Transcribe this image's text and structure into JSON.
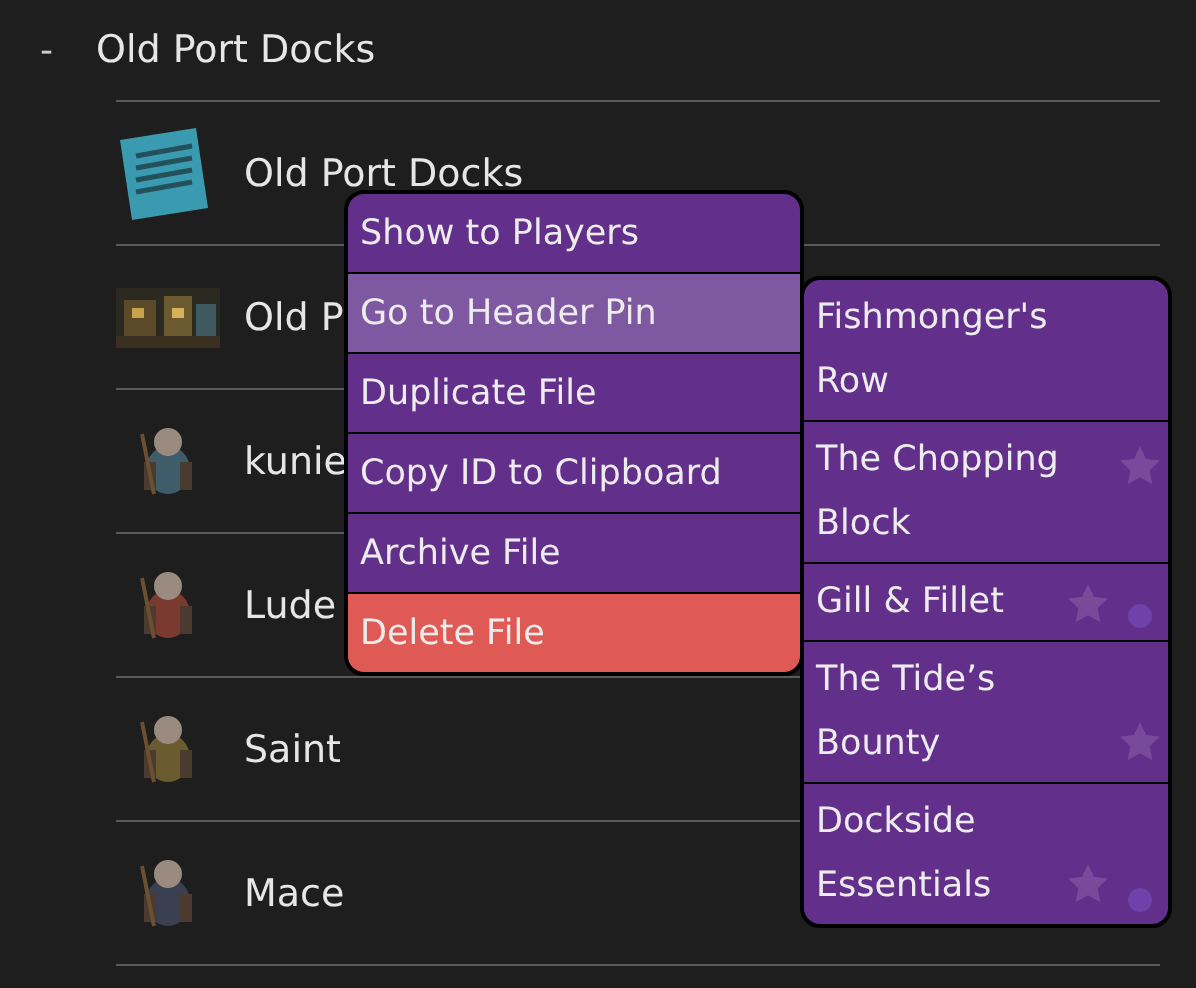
{
  "folder": {
    "toggle": "-",
    "title": "Old Port Docks",
    "expanded": true
  },
  "rows": [
    {
      "name": "Old Port Docks",
      "kind": "document"
    },
    {
      "name": "Old P",
      "kind": "scene"
    },
    {
      "name": "kunie",
      "kind": "token"
    },
    {
      "name": "Lude",
      "kind": "token"
    },
    {
      "name": "Saint",
      "kind": "token"
    },
    {
      "name": "Mace",
      "kind": "token"
    }
  ],
  "context_menu": {
    "items": [
      {
        "label": "Show to Players",
        "selected": false,
        "kind": "normal"
      },
      {
        "label": "Go to Header Pin",
        "selected": true,
        "kind": "normal"
      },
      {
        "label": "Duplicate File",
        "selected": false,
        "kind": "normal"
      },
      {
        "label": "Copy ID to Clipboard",
        "selected": false,
        "kind": "normal"
      },
      {
        "label": "Archive File",
        "selected": false,
        "kind": "normal"
      },
      {
        "label": "Delete File",
        "selected": false,
        "kind": "danger"
      }
    ]
  },
  "pin_menu": {
    "items": [
      {
        "label": "Fishmonger's Row",
        "starred": false,
        "dot": false
      },
      {
        "label": "The Chopping Block",
        "starred": true,
        "dot": false
      },
      {
        "label": "Gill & Fillet",
        "starred": true,
        "dot": true
      },
      {
        "label": "The Tide’s Bounty",
        "starred": true,
        "dot": false
      },
      {
        "label": "Dockside Essentials",
        "starred": true,
        "dot": true
      }
    ]
  }
}
